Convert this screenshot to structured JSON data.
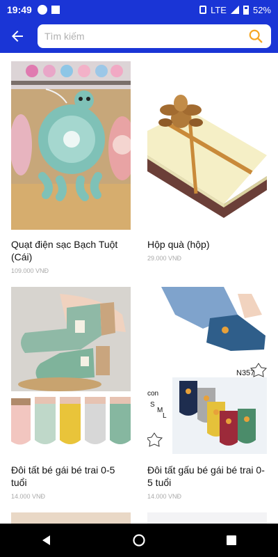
{
  "status_bar": {
    "time": "19:49",
    "network": "LTE",
    "battery": "52%"
  },
  "search": {
    "placeholder": "Tìm kiếm"
  },
  "products": [
    {
      "name": "Quạt điện sạc Bạch Tuột (Cái)",
      "price": "109.000 VNĐ",
      "image": "octopus-fans"
    },
    {
      "name": "Hộp quà (hộp)",
      "price": "29.000 VNĐ",
      "image": "gift-box"
    },
    {
      "name": "Đôi tất bé gái bé trai 0-5 tuổi",
      "price": "14.000 VNĐ",
      "image": "kids-socks"
    },
    {
      "name": "Đôi tất gấu bé gái bé trai 0-5 tuổi",
      "price": "14.000 VNĐ",
      "image": "bear-socks"
    }
  ],
  "bear_socks_tags": {
    "code": "N357",
    "sizes_prefix": "con",
    "size_s": "S",
    "size_m": "M",
    "size_l": "L"
  },
  "colors": {
    "primary": "#1a35d6",
    "search_icon": "#f5a623"
  }
}
